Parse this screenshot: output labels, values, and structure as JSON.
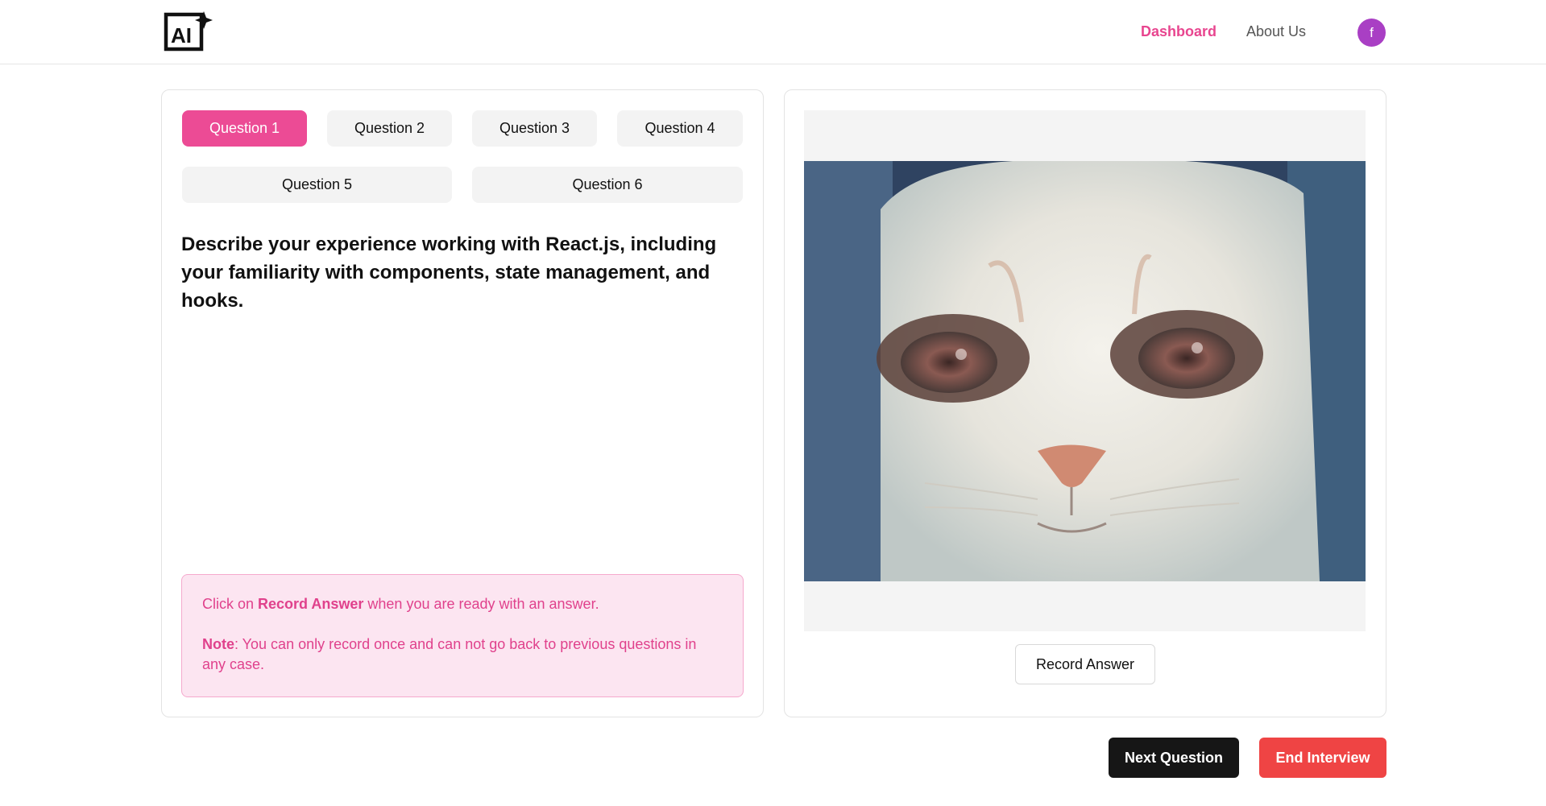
{
  "header": {
    "logo_text": "AI",
    "nav": [
      {
        "label": "Dashboard",
        "active": true
      },
      {
        "label": "About Us",
        "active": false
      }
    ],
    "avatar_initial": "f"
  },
  "questions": {
    "tabs": [
      "Question 1",
      "Question 2",
      "Question 3",
      "Question 4",
      "Question 5",
      "Question 6"
    ],
    "active_index": 0,
    "current_text": "Describe your experience working with React.js, including your familiarity with components, state management, and hooks."
  },
  "note": {
    "line1_prefix": "Click on ",
    "line1_bold": "Record Answer",
    "line1_suffix": " when you are ready with an answer.",
    "line2_bold": "Note",
    "line2_text": ": You can only record once and can not go back to previous questions in any case."
  },
  "camera": {
    "record_label": "Record Answer"
  },
  "actions": {
    "next_label": "Next Question",
    "end_label": "End Interview"
  },
  "colors": {
    "accent": "#ec4b95",
    "danger": "#ef4444",
    "dark": "#161616"
  }
}
